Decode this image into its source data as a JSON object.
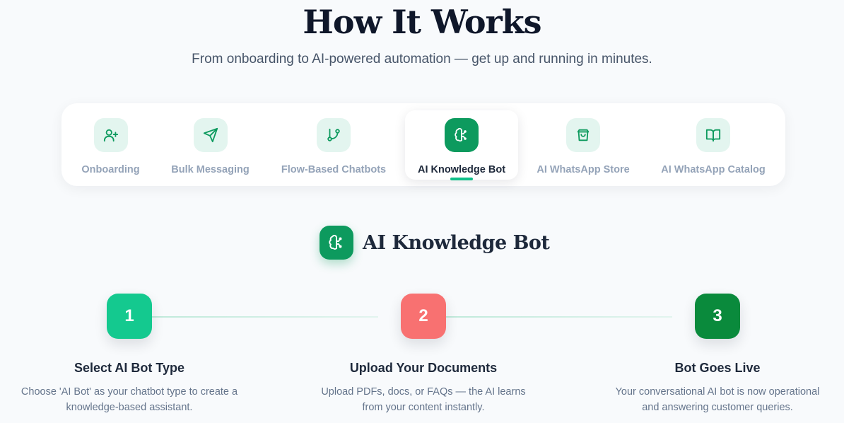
{
  "header": {
    "title": "How It Works",
    "subtitle": "From onboarding to AI-powered automation — get up and running in minutes."
  },
  "tabs": [
    {
      "label": "Onboarding",
      "icon": "user-plus-icon",
      "active": false
    },
    {
      "label": "Bulk Messaging",
      "icon": "send-icon",
      "active": false
    },
    {
      "label": "Flow-Based Chatbots",
      "icon": "git-branch-icon",
      "active": false
    },
    {
      "label": "AI Knowledge Bot",
      "icon": "brain-icon",
      "active": true
    },
    {
      "label": "AI WhatsApp Store",
      "icon": "shopping-bag-icon",
      "active": false
    },
    {
      "label": "AI WhatsApp Catalog",
      "icon": "book-open-icon",
      "active": false
    }
  ],
  "section": {
    "title": "AI Knowledge Bot",
    "icon": "brain-icon"
  },
  "steps": [
    {
      "number": "1",
      "title": "Select AI Bot Type",
      "line1": "Choose 'AI Bot' as your chatbot type to create a",
      "line2": "knowledge-based assistant.",
      "color": "#14c98f"
    },
    {
      "number": "2",
      "title": "Upload Your Documents",
      "line1": "Upload PDFs, docs, or FAQs — the AI learns",
      "line2": "from your content instantly.",
      "color": "#f87171"
    },
    {
      "number": "3",
      "title": "Bot Goes Live",
      "line1": "Your conversational AI bot is now operational",
      "line2": "and answering customer queries.",
      "color": "#0a8a3c"
    }
  ],
  "colors": {
    "accent": "#0d9a5e",
    "accent_light": "#e3f5ef",
    "underline": "#10c08a"
  }
}
